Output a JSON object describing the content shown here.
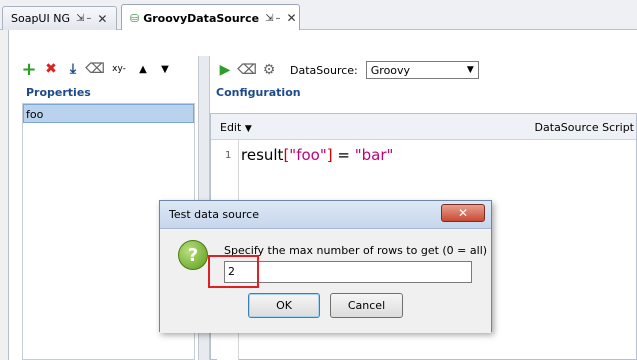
{
  "tabs": [
    {
      "label": "SoapUI NG",
      "active": false
    },
    {
      "label": "GroovyDataSource",
      "active": true
    }
  ],
  "properties": {
    "title": "Properties",
    "items": [
      "foo"
    ]
  },
  "configuration": {
    "title": "Configuration",
    "datasource_label": "DataSource:",
    "datasource_value": "Groovy"
  },
  "editor": {
    "edit_menu": "Edit",
    "script_label": "DataSource Script",
    "line_number": "1",
    "code": {
      "id": "result",
      "open": "[",
      "key": "\"foo\"",
      "close": "]",
      "op": " = ",
      "val": "\"bar\""
    }
  },
  "dialog": {
    "title": "Test data source",
    "prompt": "Specify the max number of rows to get (0 = all)",
    "input_value": "2",
    "ok_label": "OK",
    "cancel_label": "Cancel"
  },
  "colors": {
    "accent": "#1d4a8a",
    "highlight": "#e02020"
  }
}
